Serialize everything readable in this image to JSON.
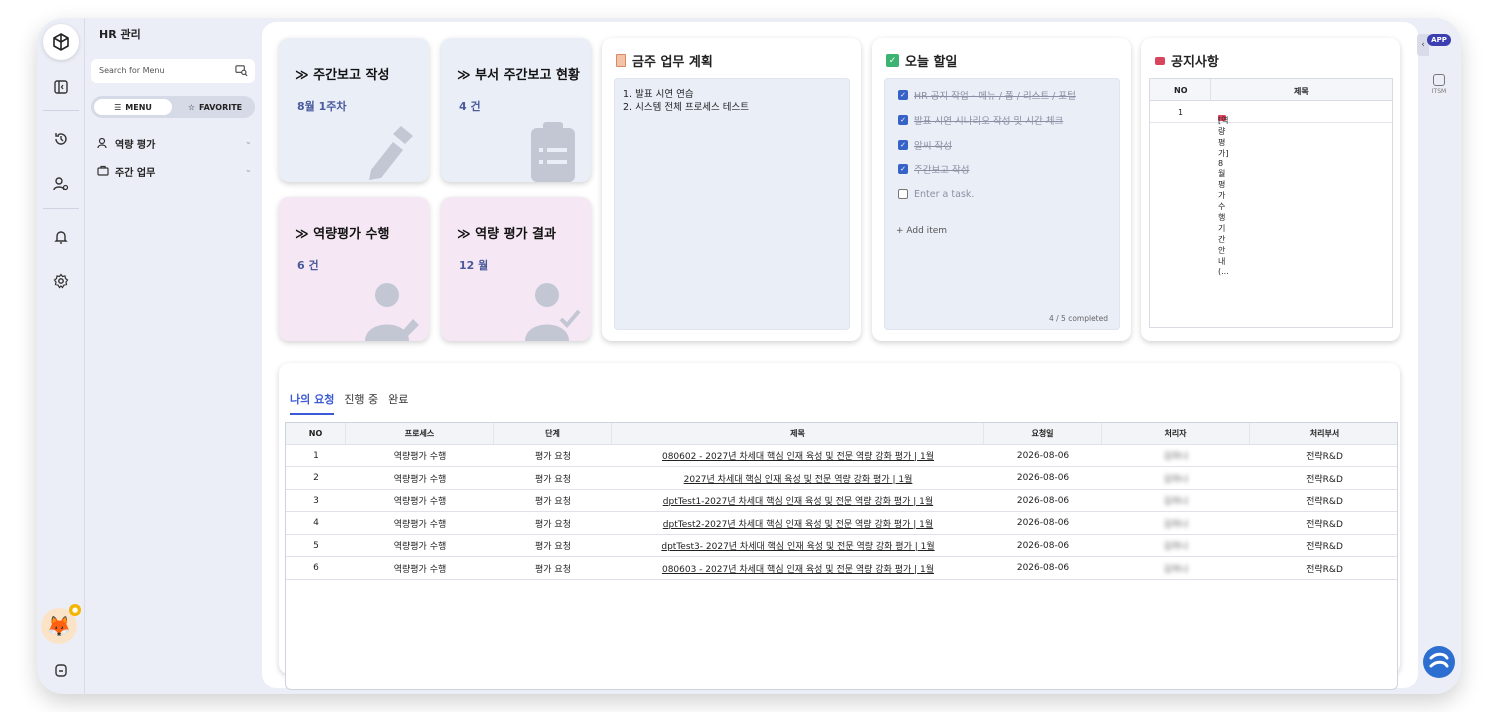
{
  "menu": {
    "title": "HR 관리",
    "search_placeholder": "Search for Menu",
    "seg_menu": "MENU",
    "seg_favorite": "FAVORITE",
    "items": [
      {
        "label": "역량 평가"
      },
      {
        "label": "주간 업무"
      }
    ]
  },
  "tiles": [
    {
      "title": "≫ 주간보고 작성",
      "value": "8월 1주차",
      "icon": "pencil-icon"
    },
    {
      "title": "≫ 부서 주간보고 현황",
      "value": "4 건",
      "icon": "clipboard-icon"
    },
    {
      "title": "≫ 역량평가 수행",
      "value": "6 건",
      "icon": "user-edit-icon"
    },
    {
      "title": "≫ 역량 평가 결과",
      "value": "12 월",
      "icon": "user-check-icon"
    }
  ],
  "plan": {
    "title": "금주 업무 계획",
    "lines": [
      "1. 발표 시연 연습",
      "2. 시스템 전체 프로세스 테스트"
    ]
  },
  "todo": {
    "title": "오늘 할일",
    "items": [
      {
        "text": "HR 공지 작업 - 메뉴 / 폼 / 리스트 / 포털",
        "done": true
      },
      {
        "text": "발표 시연 시나리오 작성 및 시간 체크",
        "done": true
      },
      {
        "text": "알씨 작성",
        "done": true
      },
      {
        "text": "주간보고 작성",
        "done": true
      }
    ],
    "new_placeholder": "Enter a task.",
    "add_label": "+  Add item",
    "completed": "4 / 5 completed"
  },
  "notice": {
    "title": "공지사항",
    "headers": [
      "NO",
      "제목"
    ],
    "rows": [
      {
        "no": "1",
        "title": "[역량 평가] 8월 평가 수행 기간 안내 (..."
      }
    ]
  },
  "requests": {
    "tabs": [
      "나의 요청",
      "진행 중",
      "완료"
    ],
    "headers": [
      "NO",
      "프로세스",
      "단계",
      "제목",
      "요청일",
      "처리자",
      "처리부서"
    ],
    "rows": [
      {
        "no": "1",
        "process": "역량평가 수행",
        "step": "평가 요청",
        "title": "080602 - 2027년 차세대 핵심 인재 육성 및 전문 역량 강화 평가 | 1월",
        "date": "2026-08-06",
        "handler": "김하나",
        "dept": "전략R&D"
      },
      {
        "no": "2",
        "process": "역량평가 수행",
        "step": "평가 요청",
        "title": "2027년 차세대 핵심 인재 육성 및 전문 역량 강화 평가 | 1월",
        "date": "2026-08-06",
        "handler": "김하나",
        "dept": "전략R&D"
      },
      {
        "no": "3",
        "process": "역량평가 수행",
        "step": "평가 요청",
        "title": "dptTest1-2027년 차세대 핵심 인재 육성 및 전문 역량 강화 평가 | 1월",
        "date": "2026-08-06",
        "handler": "김하나",
        "dept": "전략R&D"
      },
      {
        "no": "4",
        "process": "역량평가 수행",
        "step": "평가 요청",
        "title": "dptTest2-2027년 차세대 핵심 인재 육성 및 전문 역량 강화 평가 | 1월",
        "date": "2026-08-06",
        "handler": "김하나",
        "dept": "전략R&D"
      },
      {
        "no": "5",
        "process": "역량평가 수행",
        "step": "평가 요청",
        "title": "dptTest3- 2027년 차세대 핵심 인재 육성 및 전문 역량 강화 평가 | 1월",
        "date": "2026-08-06",
        "handler": "김하나",
        "dept": "전략R&D"
      },
      {
        "no": "6",
        "process": "역량평가 수행",
        "step": "평가 요청",
        "title": "080603 - 2027년 차세대 핵심 인재 육성 및 전문 역량 강화 평가 | 1월",
        "date": "2026-08-06",
        "handler": "김하나",
        "dept": "전략R&D"
      }
    ]
  },
  "right_rail": {
    "app_label": "APP",
    "itsm_label": "ITSM"
  },
  "colors": {
    "accent": "#3b5bd6",
    "tile_blue": "#e9eef7",
    "tile_pink": "#f5e8f4",
    "frame_bg": "#eceef7"
  }
}
